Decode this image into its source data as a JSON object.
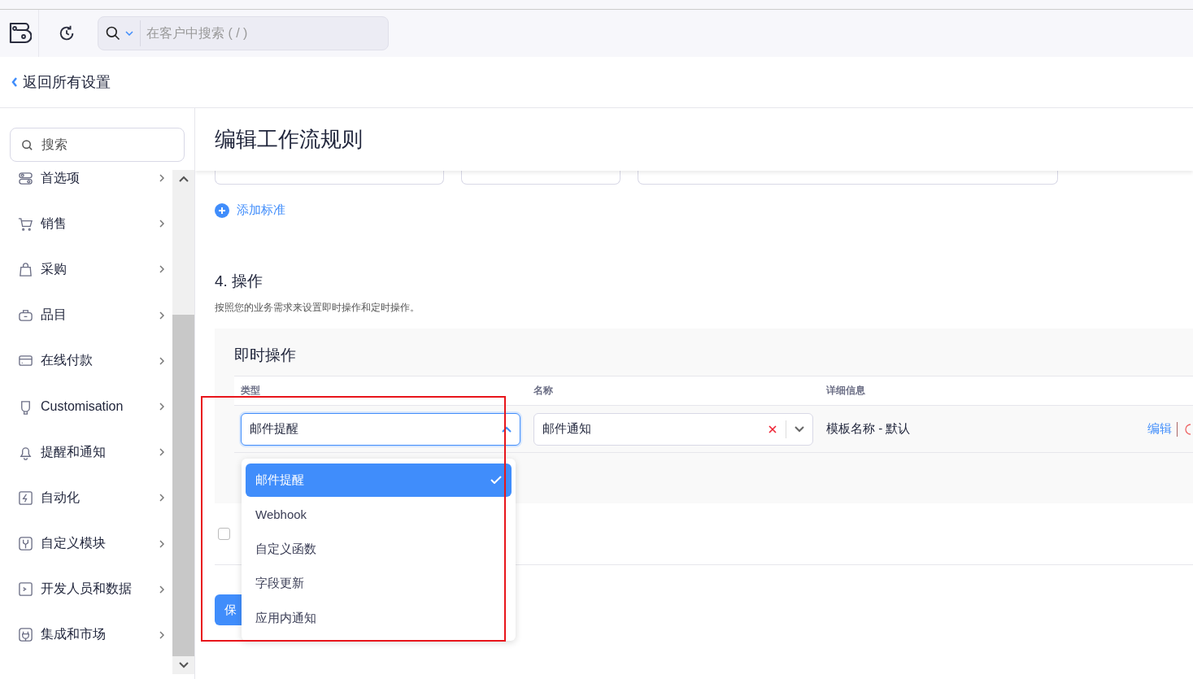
{
  "app_header": {
    "search": {
      "placeholder": "在客户中搜索 ( / )"
    }
  },
  "back_link": "返回所有设置",
  "sidebar": {
    "search": {
      "placeholder": "搜索"
    },
    "items": [
      {
        "label": "首选项",
        "kind": "prefs"
      },
      {
        "label": "销售",
        "kind": "cart"
      },
      {
        "label": "采购",
        "kind": "bag"
      },
      {
        "label": "品目",
        "kind": "basket"
      },
      {
        "label": "在线付款",
        "kind": "card"
      },
      {
        "label": "Customisation",
        "kind": "bulb"
      },
      {
        "label": "提醒和通知",
        "kind": "bell"
      },
      {
        "label": "自动化",
        "kind": "bolt"
      },
      {
        "label": "自定义模块",
        "kind": "wrench"
      },
      {
        "label": "开发人员和数据",
        "kind": "terminal"
      },
      {
        "label": "集成和市场",
        "kind": "plug"
      }
    ]
  },
  "page_title": "编辑工作流规则",
  "add_criteria": "添加标准",
  "section": {
    "title": "4. 操作",
    "description": "按照您的业务需求来设置即时操作和定时操作。"
  },
  "instant_actions": {
    "title": "即时操作",
    "columns": [
      "类型",
      "名称",
      "详细信息"
    ],
    "rows": [
      {
        "type": "邮件提醒",
        "name": "邮件通知",
        "details": "模板名称 - 默认",
        "action": "编辑"
      }
    ]
  },
  "type_dropdown": {
    "expanded": true,
    "options": [
      {
        "label": "邮件提醒",
        "selected": true
      },
      {
        "label": "Webhook",
        "selected": false
      },
      {
        "label": "自定义函数",
        "selected": false
      },
      {
        "label": "字段更新",
        "selected": false
      },
      {
        "label": "应用内通知",
        "selected": false
      }
    ]
  },
  "checkbox": {
    "checked": false
  },
  "save_button": "保"
}
